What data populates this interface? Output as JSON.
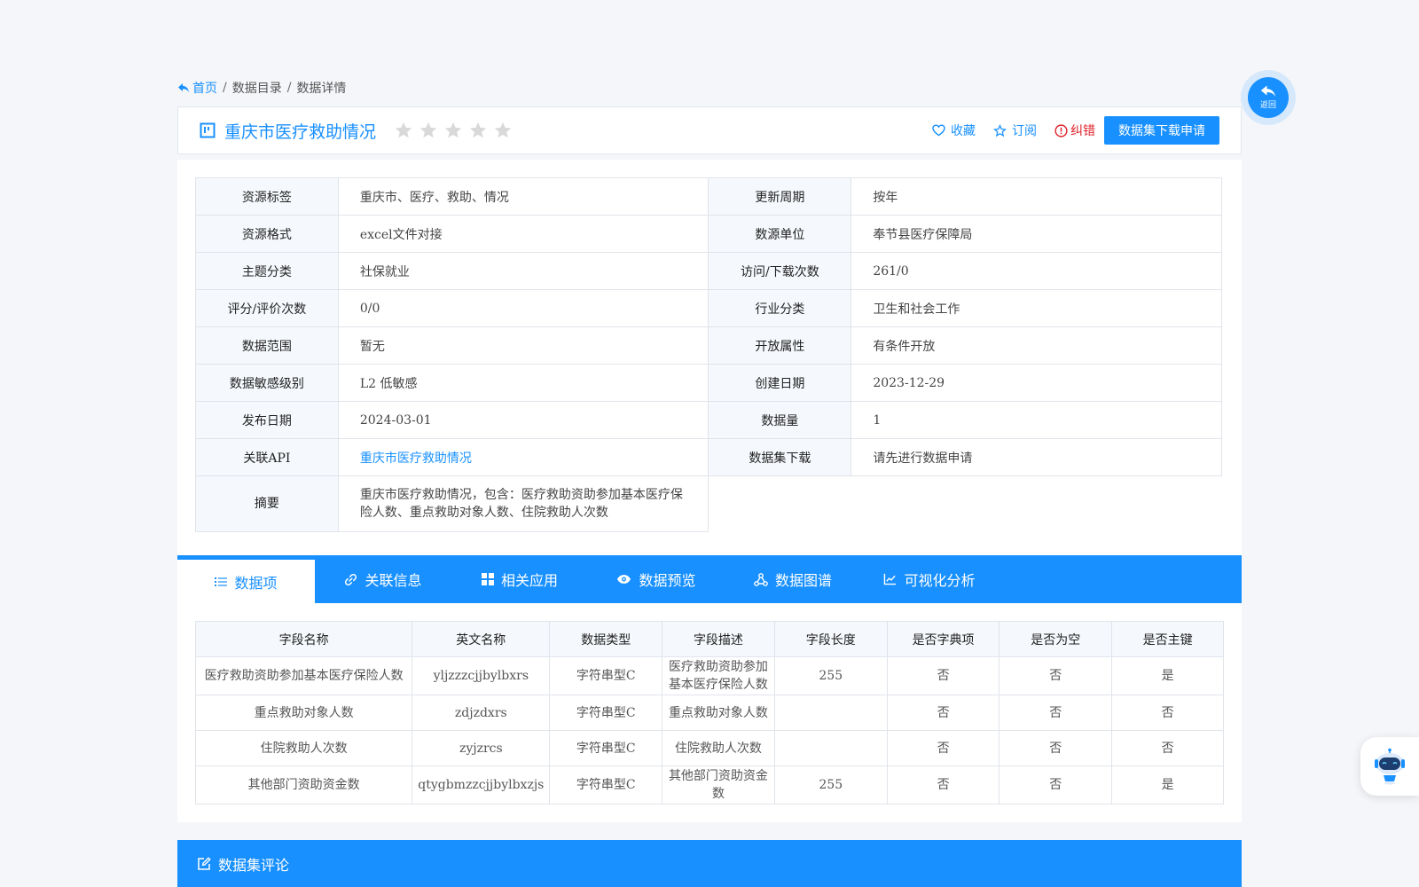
{
  "breadcrumb": {
    "home": "首页",
    "sep1": "/",
    "catalog": "数据目录",
    "sep2": "/",
    "detail": "数据详情"
  },
  "title": {
    "text": "重庆市医疗救助情况",
    "rating_stars": 0,
    "rating_max": 5
  },
  "actions": {
    "favorite": "收藏",
    "subscribe": "订阅",
    "report": "纠错",
    "apply": "数据集下载申请"
  },
  "info": {
    "rows": [
      {
        "l1": "资源标签",
        "v1": "重庆市、医疗、救助、情况",
        "l2": "更新周期",
        "v2": "按年"
      },
      {
        "l1": "资源格式",
        "v1": "excel文件对接",
        "l2": "数源单位",
        "v2": "奉节县医疗保障局"
      },
      {
        "l1": "主题分类",
        "v1": "社保就业",
        "l2": "访问/下载次数",
        "v2": "261/0"
      },
      {
        "l1": "评分/评价次数",
        "v1": "0/0",
        "l2": "行业分类",
        "v2": "卫生和社会工作"
      },
      {
        "l1": "数据范围",
        "v1": "暂无",
        "l2": "开放属性",
        "v2": "有条件开放"
      },
      {
        "l1": "数据敏感级别",
        "v1": "L2 低敏感",
        "l2": "创建日期",
        "v2": "2023-12-29"
      },
      {
        "l1": "发布日期",
        "v1": "2024-03-01",
        "l2": "数据量",
        "v2": "1"
      },
      {
        "l1": "关联API",
        "v1": "重庆市医疗救助情况",
        "l2": "数据集下载",
        "v2": "请先进行数据申请"
      }
    ],
    "summary_label": "摘要",
    "summary_value": "重庆市医疗救助情况，包含：医疗救助资助参加基本医疗保险人数、重点救助对象人数、住院救助人次数"
  },
  "tabs": [
    {
      "label": "数据项",
      "icon": "list-icon"
    },
    {
      "label": "关联信息",
      "icon": "link-icon"
    },
    {
      "label": "相关应用",
      "icon": "grid-icon"
    },
    {
      "label": "数据预览",
      "icon": "eye-icon"
    },
    {
      "label": "数据图谱",
      "icon": "graph-icon"
    },
    {
      "label": "可视化分析",
      "icon": "line-chart-icon"
    }
  ],
  "fields": {
    "headers": [
      "字段名称",
      "英文名称",
      "数据类型",
      "字段描述",
      "字段长度",
      "是否字典项",
      "是否为空",
      "是否主键"
    ],
    "rows": [
      [
        "医疗救助资助参加基本医疗保险人数",
        "yljzzzcjjbylbxrs",
        "字符串型C",
        "医疗救助资助参加基本医疗保险人数",
        "255",
        "否",
        "否",
        "是"
      ],
      [
        "重点救助对象人数",
        "zdjzdxrs",
        "字符串型C",
        "重点救助对象人数",
        "",
        "否",
        "否",
        "否"
      ],
      [
        "住院救助人次数",
        "zyjzrcs",
        "字符串型C",
        "住院救助人次数",
        "",
        "否",
        "否",
        "否"
      ],
      [
        "其他部门资助资金数",
        "qtygbmzzcjjbylbxzjs",
        "字符串型C",
        "其他部门资助资金数",
        "255",
        "否",
        "否",
        "是"
      ]
    ]
  },
  "comment": {
    "title": "数据集评论"
  },
  "back_float": {
    "label": "返回"
  },
  "colors": {
    "primary": "#1890ff",
    "danger": "#e0202a",
    "star": "#d9d9d9"
  }
}
